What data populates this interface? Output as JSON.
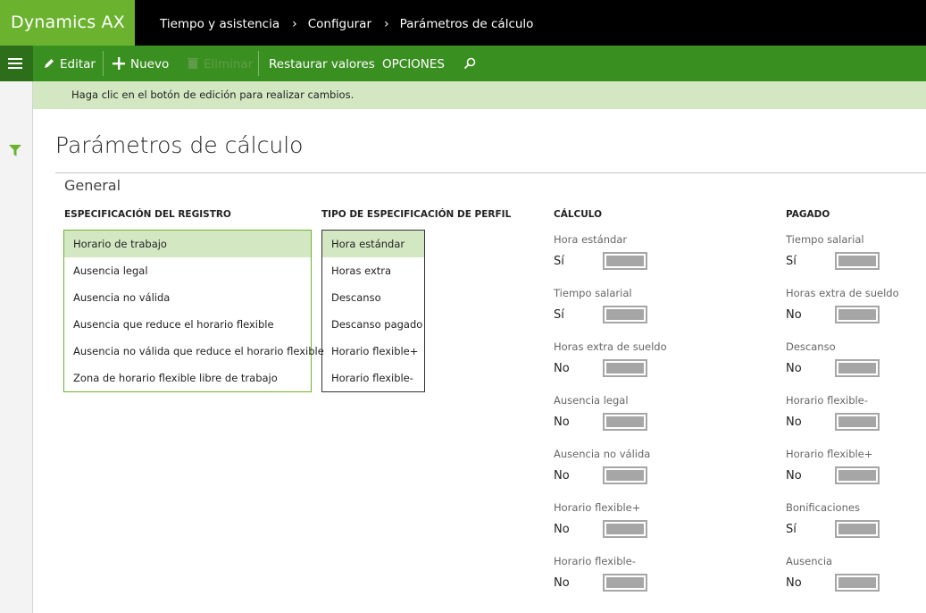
{
  "app": {
    "title": "Dynamics AX"
  },
  "breadcrumb": {
    "items": [
      "Tiempo y asistencia",
      "Configurar",
      "Parámetros de cálculo"
    ]
  },
  "toolbar": {
    "edit_label": "Editar",
    "new_label": "Nuevo",
    "delete_label": "Eliminar",
    "restore_label": "Restaurar valores",
    "options_label": "OPCIONES"
  },
  "message": "Haga clic en el botón de edición para realizar cambios.",
  "page": {
    "title": "Parámetros de cálculo",
    "section": "General"
  },
  "registro": {
    "header": "ESPECIFICACIÓN DEL REGISTRO",
    "items": [
      {
        "label": "Horario de trabajo",
        "selected": true
      },
      {
        "label": "Ausencia legal",
        "selected": false
      },
      {
        "label": "Ausencia no válida",
        "selected": false
      },
      {
        "label": "Ausencia que reduce el horario flexible",
        "selected": false
      },
      {
        "label": "Ausencia no válida que reduce el horario flexible",
        "selected": false
      },
      {
        "label": "Zona de horario flexible libre de trabajo",
        "selected": false
      }
    ]
  },
  "perfil": {
    "header": "TIPO DE ESPECIFICACIÓN DE PERFIL",
    "items": [
      {
        "label": "Hora estándar",
        "selected": true
      },
      {
        "label": "Horas extra",
        "selected": false
      },
      {
        "label": "Descanso",
        "selected": false
      },
      {
        "label": "Descanso pagado",
        "selected": false
      },
      {
        "label": "Horario flexible+",
        "selected": false
      },
      {
        "label": "Horario flexible-",
        "selected": false
      }
    ]
  },
  "calculo": {
    "header": "CÁLCULO",
    "fields": [
      {
        "label": "Hora estándar",
        "value": "Sí"
      },
      {
        "label": "Tiempo salarial",
        "value": "Sí"
      },
      {
        "label": "Horas extra de sueldo",
        "value": "No"
      },
      {
        "label": "Ausencia legal",
        "value": "No"
      },
      {
        "label": "Ausencia no válida",
        "value": "No"
      },
      {
        "label": "Horario flexible+",
        "value": "No"
      },
      {
        "label": "Horario flexible-",
        "value": "No"
      }
    ]
  },
  "pagado": {
    "header": "PAGADO",
    "fields": [
      {
        "label": "Tiempo salarial",
        "value": "Sí"
      },
      {
        "label": "Horas extra de sueldo",
        "value": "No"
      },
      {
        "label": "Descanso",
        "value": "No"
      },
      {
        "label": "Horario flexible-",
        "value": "No"
      },
      {
        "label": "Horario flexible+",
        "value": "No"
      },
      {
        "label": "Bonificaciones",
        "value": "Sí"
      },
      {
        "label": "Ausencia",
        "value": "No"
      }
    ]
  },
  "colors": {
    "brand": "#6bb32e",
    "actionbar": "#3a8f21",
    "message_bg": "#d3e8c2",
    "filter_icon": "#6bb32e"
  }
}
